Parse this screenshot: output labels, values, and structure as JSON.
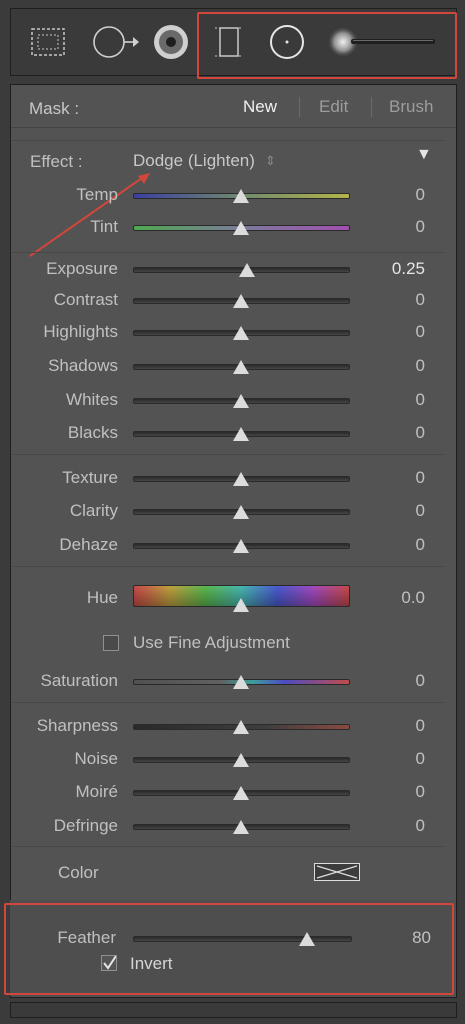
{
  "toolbar": {
    "tools": [
      {
        "icon": "graduated-filter-icon"
      },
      {
        "icon": "spot-removal-icon"
      },
      {
        "icon": "red-eye-icon"
      },
      {
        "icon": "crop-frame-icon"
      },
      {
        "icon": "radial-filter-icon"
      },
      {
        "icon": "brush-icon"
      }
    ]
  },
  "mask": {
    "label": "Mask :",
    "tabs": [
      "New",
      "Edit",
      "Brush"
    ],
    "active_tab": "New"
  },
  "effect": {
    "label": "Effect :",
    "value": "Dodge (Lighten)",
    "stepper": "⇕",
    "collapse": "▼"
  },
  "wb": [
    {
      "label": "Temp",
      "value": "0",
      "level": 0.5
    },
    {
      "label": "Tint",
      "value": "0",
      "level": 0.5
    }
  ],
  "tone": [
    {
      "label": "Exposure",
      "value": "0.25",
      "level": 0.53
    },
    {
      "label": "Contrast",
      "value": "0",
      "level": 0.5
    },
    {
      "label": "Highlights",
      "value": "0",
      "level": 0.5
    },
    {
      "label": "Shadows",
      "value": "0",
      "level": 0.5
    },
    {
      "label": "Whites",
      "value": "0",
      "level": 0.5
    },
    {
      "label": "Blacks",
      "value": "0",
      "level": 0.5
    }
  ],
  "presence": [
    {
      "label": "Texture",
      "value": "0",
      "level": 0.5
    },
    {
      "label": "Clarity",
      "value": "0",
      "level": 0.5
    },
    {
      "label": "Dehaze",
      "value": "0",
      "level": 0.5
    }
  ],
  "hue": {
    "label": "Hue",
    "value": "0.0",
    "level": 0.5
  },
  "fine_adjust": {
    "label": "Use Fine Adjustment",
    "checked": false
  },
  "saturation": {
    "label": "Saturation",
    "value": "0",
    "level": 0.5
  },
  "detail": [
    {
      "label": "Sharpness",
      "value": "0",
      "level": 0.5
    },
    {
      "label": "Noise",
      "value": "0",
      "level": 0.5
    },
    {
      "label": "Moiré",
      "value": "0",
      "level": 0.5
    },
    {
      "label": "Defringe",
      "value": "0",
      "level": 0.5
    }
  ],
  "color": {
    "label": "Color"
  },
  "feather": {
    "label": "Feather",
    "value": "80",
    "level": 0.8
  },
  "invert": {
    "label": "Invert",
    "checked": true
  },
  "colors": {
    "highlight": "#d2473b",
    "panel": "#535353",
    "background": "#3b3b3b"
  }
}
